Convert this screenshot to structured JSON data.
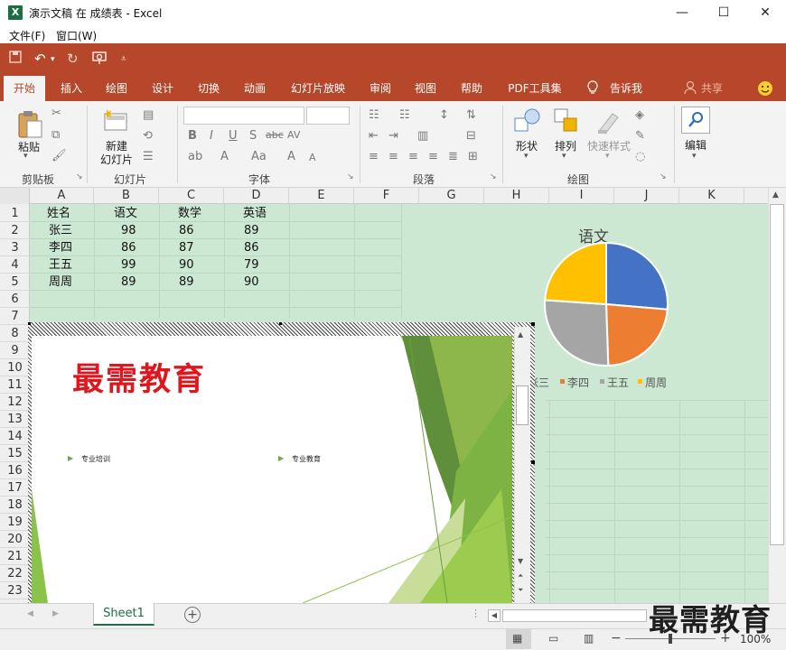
{
  "window": {
    "title": "演示文稿 在 成绩表 - Excel",
    "app_icon": "X",
    "minimize": "—",
    "maximize": "☐",
    "close": "✕"
  },
  "menubar": {
    "file": "文件(F)",
    "window": "窗口(W)"
  },
  "tabs": [
    "开始",
    "插入",
    "绘图",
    "设计",
    "切换",
    "动画",
    "幻灯片放映",
    "审阅",
    "视图",
    "帮助",
    "PDF工具集",
    "告诉我"
  ],
  "share": "共享",
  "ribbon": {
    "paste": "粘贴",
    "new_slide_1": "新建",
    "new_slide_2": "幻灯片",
    "shapes": "形状",
    "arrange": "排列",
    "quick_styles": "快速样式",
    "edit": "编辑",
    "groups": {
      "clipboard": "剪贴板",
      "slides": "幻灯片",
      "font": "字体",
      "paragraph": "段落",
      "drawing": "绘图"
    },
    "font_buttons": [
      "B",
      "I",
      "U",
      "S",
      "abc",
      "AV"
    ]
  },
  "grid": {
    "columns": [
      "A",
      "B",
      "C",
      "D",
      "E",
      "F",
      "G",
      "H",
      "I",
      "J",
      "K"
    ],
    "rows": [
      "1",
      "2",
      "3",
      "4",
      "5",
      "6",
      "7",
      "8",
      "9",
      "10",
      "11",
      "12",
      "13",
      "14",
      "15",
      "16",
      "17",
      "18",
      "19",
      "20",
      "21",
      "22",
      "23"
    ],
    "table": [
      [
        "姓名",
        "语文",
        "数学",
        "英语"
      ],
      [
        "张三",
        "98",
        "86",
        "89"
      ],
      [
        "李四",
        "86",
        "87",
        "86"
      ],
      [
        "王五",
        "99",
        "90",
        "79"
      ],
      [
        "周周",
        "89",
        "89",
        "90"
      ]
    ]
  },
  "chart_data": {
    "type": "pie",
    "title": "语文",
    "categories": [
      "张三",
      "李四",
      "王五",
      "周周"
    ],
    "values": [
      98,
      86,
      99,
      89
    ],
    "colors": [
      "#4472c4",
      "#ed7d31",
      "#a5a5a5",
      "#ffc000"
    ],
    "legend_position": "bottom"
  },
  "slide": {
    "title": "最需教育",
    "bullet1": "专业培训",
    "bullet2": "专业教育",
    "title_color": "#e0161e"
  },
  "sheet_tab": "Sheet1",
  "status": {
    "zoom": "100%"
  },
  "watermark": "最需教育",
  "colors": {
    "accent": "#b7472a",
    "excel_green": "#1d6f42"
  }
}
